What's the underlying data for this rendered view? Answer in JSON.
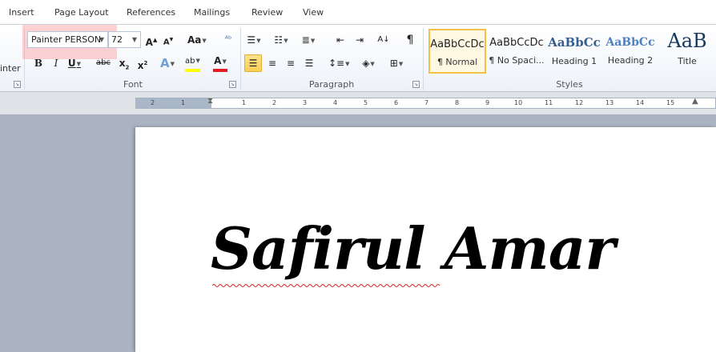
{
  "tabs": [
    "Insert",
    "Page Layout",
    "References",
    "Mailings",
    "Review",
    "View"
  ],
  "clipboard": {
    "partial_label": "inter"
  },
  "font": {
    "name": "Painter PERSON",
    "size": "72",
    "group_label": "Font"
  },
  "paragraph": {
    "group_label": "Paragraph"
  },
  "styles": {
    "group_label": "Styles",
    "items": [
      {
        "preview": "AaBbCcDc",
        "name": "¶ Normal"
      },
      {
        "preview": "AaBbCcDc",
        "name": "¶ No Spaci..."
      },
      {
        "preview": "AaBbCc",
        "name": "Heading 1"
      },
      {
        "preview": "AaBbCc",
        "name": "Heading 2"
      },
      {
        "preview": "AaB",
        "name": "Title"
      }
    ]
  },
  "ruler": {
    "left_numbers": [
      "2",
      "1"
    ],
    "right_numbers": [
      "1",
      "2",
      "3",
      "4",
      "5",
      "6",
      "7",
      "8",
      "9",
      "10",
      "11",
      "12",
      "13",
      "14",
      "15"
    ]
  },
  "document": {
    "text": "Safirul Amar"
  },
  "colors": {
    "highlight_yellow": "#ffff00",
    "font_red": "#e02020",
    "heading_blue": "#365f91",
    "selected_style_border": "#f1c24a",
    "spellcheck_red": "#e02020"
  },
  "icons": {
    "grow_font": "grow-font-icon",
    "shrink_font": "shrink-font-icon",
    "change_case": "change-case-icon",
    "clear_format": "clear-formatting-icon",
    "bold": "bold-icon",
    "italic": "italic-icon",
    "underline": "underline-icon",
    "strikethrough": "strikethrough-icon",
    "subscript": "subscript-icon",
    "superscript": "superscript-icon",
    "text_effects": "text-effects-icon",
    "highlight": "highlight-icon",
    "font_color": "font-color-icon",
    "bullets": "bullets-icon",
    "numbering": "numbering-icon",
    "multilevel": "multilevel-list-icon",
    "decrease_indent": "decrease-indent-icon",
    "increase_indent": "increase-indent-icon",
    "sort": "sort-icon",
    "show_marks": "show-formatting-marks-icon",
    "align_left": "align-left-icon",
    "align_center": "align-center-icon",
    "align_right": "align-right-icon",
    "justify": "justify-icon",
    "line_spacing": "line-spacing-icon",
    "shading": "shading-icon",
    "borders": "borders-icon"
  }
}
